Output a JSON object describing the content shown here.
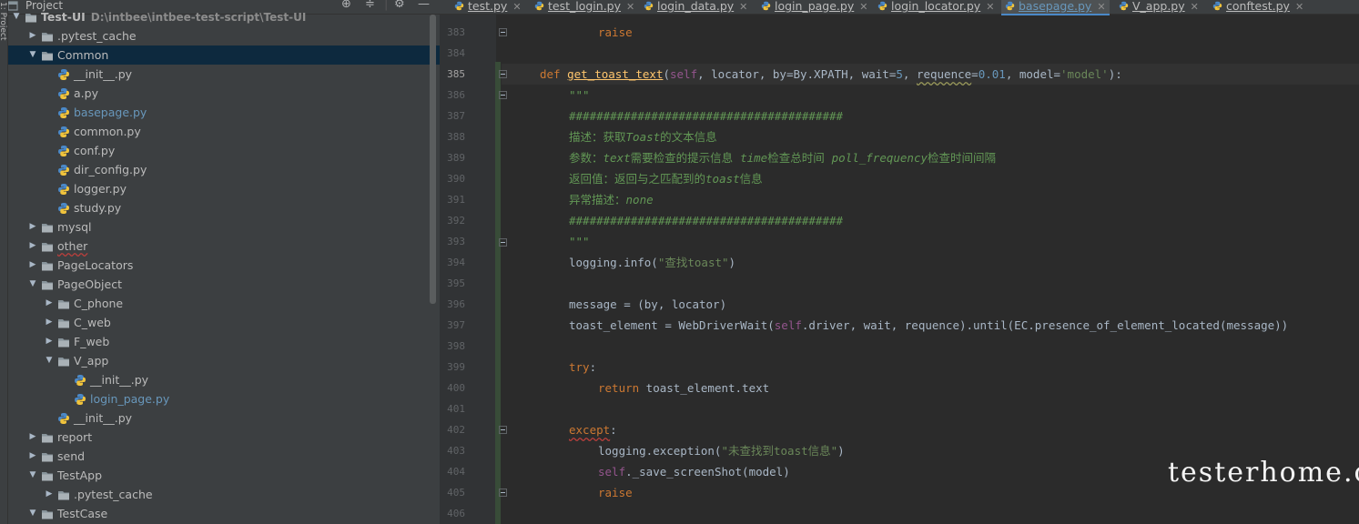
{
  "project_panel": {
    "title": "Project",
    "controls": [
      "crosshair-icon",
      "collapse-icon",
      "gear-icon",
      "minimize-icon"
    ],
    "side_label": "1: Project",
    "tree": [
      {
        "label": "Test-UI",
        "path": "D:\\intbee\\intbee-test-script\\Test-UI",
        "type": "folder",
        "expanded": true,
        "depth": 0,
        "bold": true
      },
      {
        "label": ".pytest_cache",
        "type": "folder",
        "expanded": false,
        "depth": 1
      },
      {
        "label": "Common",
        "type": "folder",
        "expanded": true,
        "depth": 1,
        "selected": true
      },
      {
        "label": "__init__.py",
        "type": "py",
        "depth": 2
      },
      {
        "label": "a.py",
        "type": "py",
        "depth": 2
      },
      {
        "label": "basepage.py",
        "type": "py",
        "depth": 2,
        "modified": true
      },
      {
        "label": "common.py",
        "type": "py",
        "depth": 2
      },
      {
        "label": "conf.py",
        "type": "py",
        "depth": 2
      },
      {
        "label": "dir_config.py",
        "type": "py",
        "depth": 2
      },
      {
        "label": "logger.py",
        "type": "py",
        "depth": 2
      },
      {
        "label": "study.py",
        "type": "py",
        "depth": 2
      },
      {
        "label": "mysql",
        "type": "folder",
        "expanded": false,
        "depth": 1
      },
      {
        "label": "other",
        "type": "folder",
        "expanded": false,
        "depth": 1,
        "error": true
      },
      {
        "label": "PageLocators",
        "type": "folder",
        "expanded": false,
        "depth": 1
      },
      {
        "label": "PageObject",
        "type": "folder",
        "expanded": true,
        "depth": 1
      },
      {
        "label": "C_phone",
        "type": "folder",
        "expanded": false,
        "depth": 2
      },
      {
        "label": "C_web",
        "type": "folder",
        "expanded": false,
        "depth": 2
      },
      {
        "label": "F_web",
        "type": "folder",
        "expanded": false,
        "depth": 2
      },
      {
        "label": "V_app",
        "type": "folder",
        "expanded": true,
        "depth": 2
      },
      {
        "label": "__init__.py",
        "type": "py",
        "depth": 3
      },
      {
        "label": "login_page.py",
        "type": "py",
        "depth": 3,
        "modified": true
      },
      {
        "label": "__init__.py",
        "type": "py",
        "depth": 2
      },
      {
        "label": "report",
        "type": "folder",
        "expanded": false,
        "depth": 1
      },
      {
        "label": "send",
        "type": "folder",
        "expanded": false,
        "depth": 1
      },
      {
        "label": "TestApp",
        "type": "folder",
        "expanded": true,
        "depth": 1
      },
      {
        "label": ".pytest_cache",
        "type": "folder",
        "expanded": false,
        "depth": 2
      },
      {
        "label": "TestCase",
        "type": "folder",
        "expanded": true,
        "depth": 1
      }
    ]
  },
  "editor": {
    "tabs": [
      {
        "label": "test.py",
        "active": false
      },
      {
        "label": "test_login.py",
        "active": false
      },
      {
        "label": "login_data.py",
        "active": false
      },
      {
        "label": "login_page.py",
        "active": false
      },
      {
        "label": "login_locator.py",
        "active": false
      },
      {
        "label": "basepage.py",
        "active": true
      },
      {
        "label": "V_app.py",
        "active": false
      },
      {
        "label": "conftest.py",
        "active": false
      }
    ],
    "line_numbers": [
      "383",
      "384",
      "385",
      "386",
      "387",
      "388",
      "389",
      "390",
      "391",
      "392",
      "393",
      "394",
      "395",
      "396",
      "397",
      "398",
      "399",
      "400",
      "401",
      "402",
      "403",
      "404",
      "405",
      "406"
    ],
    "current_line": "385",
    "code": {
      "l383_kw": "raise",
      "l385_def": "def",
      "l385_fn": "get_toast_text",
      "l385_p1": "(",
      "l385_self": "self",
      "l385_p2": ", locator, by=By.XPATH, wait=",
      "l385_n1": "5",
      "l385_p3": ", ",
      "l385_req": "requence",
      "l385_p4": "=",
      "l385_n2": "0.01",
      "l385_p5": ", model=",
      "l385_s1": "'model'",
      "l385_p6": "):",
      "l386_doc": "\"\"\"",
      "l387_doc": "########################################",
      "l388_a": "描述：获取",
      "l388_b": "Toast",
      "l388_c": "的文本信息",
      "l389_a": "参数：",
      "l389_b": "text",
      "l389_c": "需要检查的提示信息  ",
      "l389_d": "time",
      "l389_e": "检查总时间  ",
      "l389_f": "poll_frequency",
      "l389_g": "检查时间间隔",
      "l390_a": "返回值：返回与之匹配到的",
      "l390_b": "toast",
      "l390_c": "信息",
      "l391_a": "异常描述：",
      "l391_b": "none",
      "l392_doc": "########################################",
      "l393_doc": "\"\"\"",
      "l394_a": "logging.info(",
      "l394_s": "\"查找toast\"",
      "l394_b": ")",
      "l396": "message = (by, locator)",
      "l397_a": "toast_element = WebDriverWait(",
      "l397_self": "self",
      "l397_b": ".driver, wait, requence).until(EC.presence_of_element_located(message))",
      "l399_kw": "try",
      "l399_c": ":",
      "l400_kw": "return",
      "l400_b": " toast_element.text",
      "l402_kw": "except",
      "l402_c": ":",
      "l403_a": "logging.exception(",
      "l403_s": "\"未查找到toast信息\"",
      "l403_b": ")",
      "l404_self": "self",
      "l404_b": "._save_screenShot(model)",
      "l405_kw": "raise"
    }
  },
  "watermark": "testerhome.com",
  "colors": {
    "background": "#2b2b2b",
    "panel": "#3c3f41",
    "keyword": "#cc7832",
    "function": "#ffc66d",
    "self": "#94558d",
    "number": "#6897bb",
    "string": "#6a8759",
    "docstring": "#629755",
    "selection": "#0d293e"
  }
}
